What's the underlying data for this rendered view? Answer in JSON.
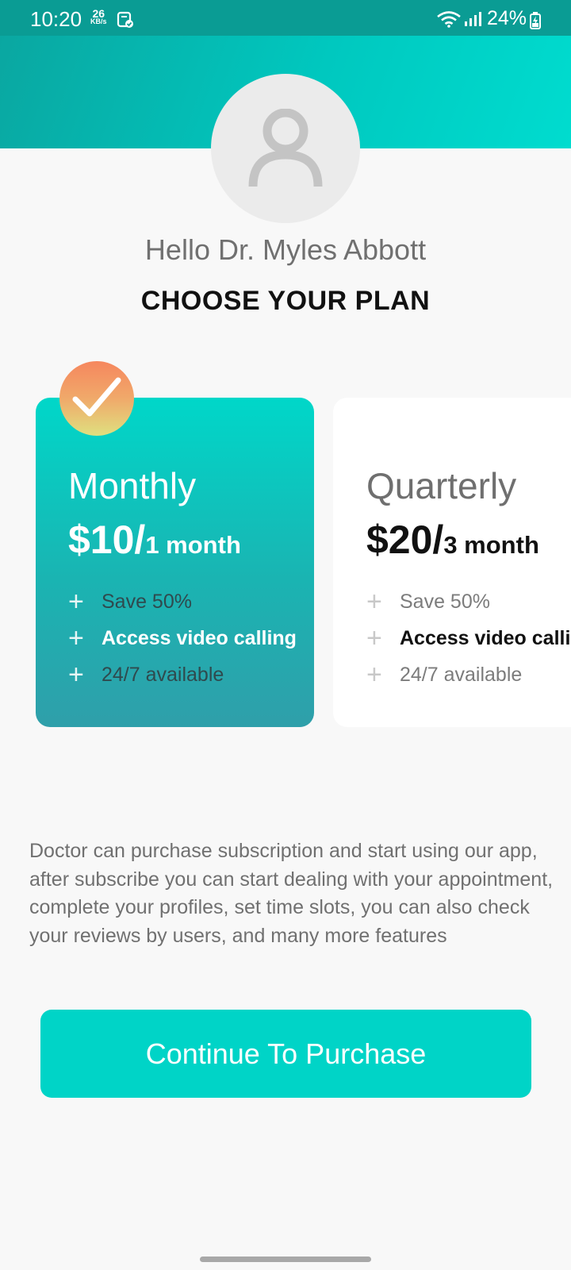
{
  "status_bar": {
    "time": "10:20",
    "net_speed_value": "26",
    "net_speed_unit": "KB/s",
    "battery": "24%",
    "icons": [
      "document-check-icon",
      "wifi-icon",
      "signal-icon",
      "battery-charging-icon"
    ]
  },
  "header": {
    "avatar_icon": "user-placeholder-icon",
    "greeting": "Hello Dr. Myles Abbott",
    "title": "CHOOSE YOUR PLAN"
  },
  "plans": [
    {
      "name": "Monthly",
      "price": "$10/",
      "period": "1 month",
      "selected": true,
      "features": [
        "Save 50%",
        "Access video calling",
        "24/7 available"
      ]
    },
    {
      "name": "Quarterly",
      "price": "$20/",
      "period": "3 month",
      "selected": false,
      "features": [
        "Save 50%",
        "Access video calling",
        "24/7 available"
      ]
    }
  ],
  "description": "Doctor can purchase subscription and start using our app, after subscribe you can start dealing with your appointment, complete your profiles, set time slots, you can also check your reviews by users, and many more features",
  "purchase_button": "Continue To Purchase",
  "colors": {
    "accent": "#00d4c7",
    "header_start": "#0aa7a1",
    "badge_start": "#f6875e",
    "badge_end": "#dfe07f"
  }
}
